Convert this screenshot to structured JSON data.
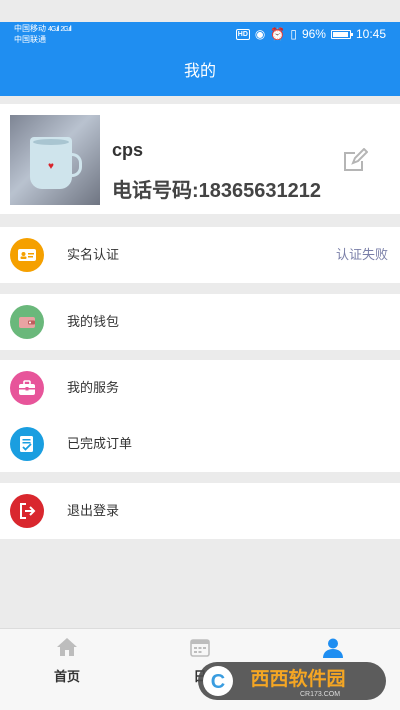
{
  "status": {
    "carrier1": "中国移动",
    "carrier2": "中国联通",
    "net1": "4G",
    "net2": "2G",
    "battery": "96%",
    "time": "10:45",
    "hd_label": "HD"
  },
  "header": {
    "title": "我的"
  },
  "profile": {
    "name": "cps",
    "phone": "电话号码:18365631212"
  },
  "menu": {
    "verify": {
      "label": "实名认证",
      "status": "认证失败",
      "icon": "id-card-icon",
      "color": "#f5a000"
    },
    "wallet": {
      "label": "我的钱包",
      "icon": "wallet-icon",
      "color": "#6ab87b"
    },
    "service": {
      "label": "我的服务",
      "icon": "briefcase-icon",
      "color": "#e7559a"
    },
    "orders": {
      "label": "已完成订单",
      "icon": "document-check-icon",
      "color": "#1a9ee0"
    },
    "logout": {
      "label": "退出登录",
      "icon": "logout-icon",
      "color": "#d9272e"
    }
  },
  "tabs": [
    {
      "label": "首页",
      "icon": "home-icon"
    },
    {
      "label": "日",
      "icon": "calendar-icon"
    },
    {
      "label": "",
      "icon": "user-icon"
    }
  ],
  "colors": {
    "primary": "#1f8ef1",
    "background": "#ebebeb",
    "status_text": "#7a7fa8"
  },
  "watermark": {
    "main": "西西软件园",
    "sub": "CR173.COM"
  }
}
